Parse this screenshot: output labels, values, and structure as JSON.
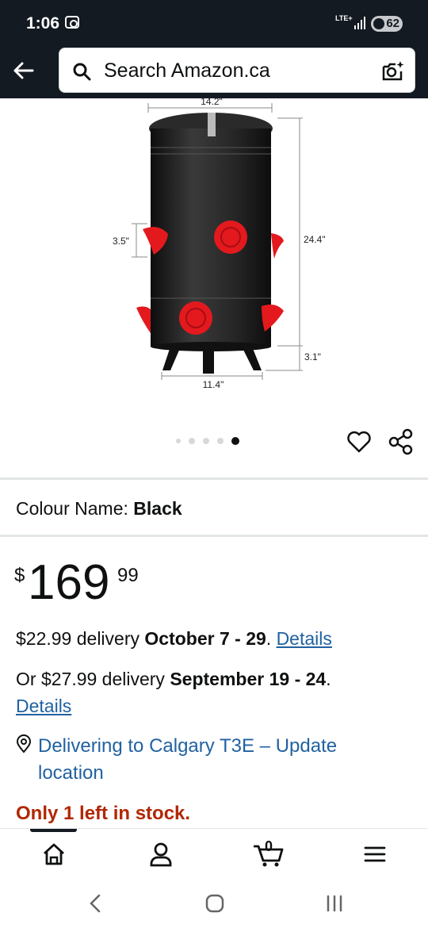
{
  "status_bar": {
    "time": "1:06",
    "network": "LTE+",
    "battery": "62"
  },
  "header": {
    "search_placeholder": "Search Amazon.ca"
  },
  "product_image": {
    "dim_top": "14.2\"",
    "dim_side_left": "3.5\"",
    "dim_height": "24.4\"",
    "dim_legs": "3.1\"",
    "dim_bottom": "11.4\""
  },
  "carousel": {
    "total": 5,
    "active_index": 4
  },
  "colour": {
    "label": "Colour Name:",
    "value": "Black"
  },
  "price": {
    "currency": "$",
    "whole": "169",
    "fraction": "99"
  },
  "delivery": {
    "line1_price": "$22.99 delivery",
    "line1_dates": "October 7 - 29",
    "line1_period": ".",
    "line1_link": "Details",
    "line2_price": "Or $27.99 delivery",
    "line2_dates": "September 19 - 24",
    "line2_period": ".",
    "line2_link": "Details"
  },
  "location": {
    "text": "Delivering to Calgary T3E – Update location"
  },
  "stock": {
    "text": "Only 1 left in stock."
  },
  "bottom_nav": {
    "cart_count": "0"
  },
  "colors": {
    "header_bg": "#131a22",
    "link": "#2162a1",
    "stock_red": "#b12704",
    "feeder_red": "#e3191e"
  }
}
